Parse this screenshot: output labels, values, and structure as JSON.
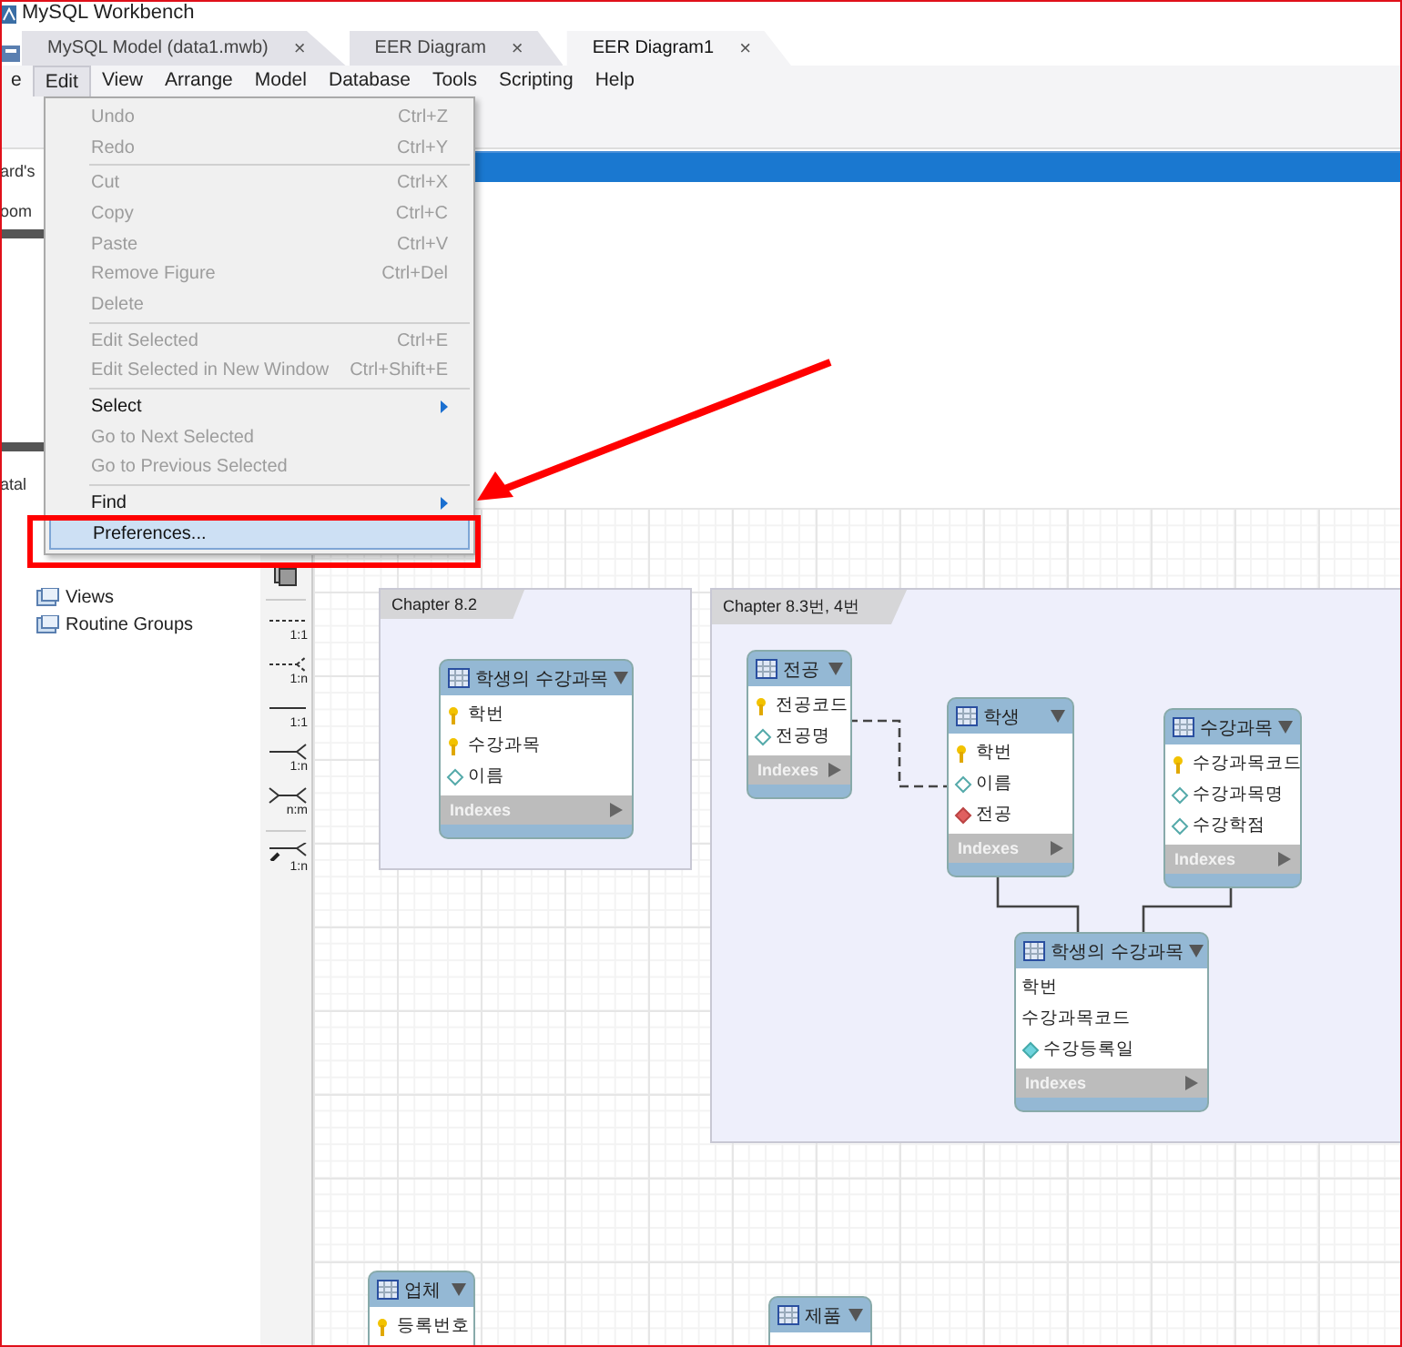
{
  "window": {
    "title": "MySQL Workbench"
  },
  "tabs": [
    {
      "label": "MySQL Model (data1.mwb)",
      "close": "×",
      "selected": false
    },
    {
      "label": "EER Diagram",
      "close": "×",
      "selected": false
    },
    {
      "label": "EER Diagram1",
      "close": "×",
      "selected": true
    }
  ],
  "menu_bar": [
    {
      "label": "e",
      "selected": false
    },
    {
      "label": "Edit",
      "selected": true
    },
    {
      "label": "View",
      "selected": false
    },
    {
      "label": "Arrange",
      "selected": false
    },
    {
      "label": "Model",
      "selected": false
    },
    {
      "label": "Database",
      "selected": false
    },
    {
      "label": "Tools",
      "selected": false
    },
    {
      "label": "Scripting",
      "selected": false
    },
    {
      "label": "Help",
      "selected": false
    }
  ],
  "edit_menu": [
    {
      "kind": "item",
      "label": "Undo",
      "shortcut": "Ctrl+Z",
      "disabled": true,
      "selected": false
    },
    {
      "kind": "item",
      "label": "Redo",
      "shortcut": "Ctrl+Y",
      "disabled": true,
      "selected": false
    },
    {
      "kind": "separator"
    },
    {
      "kind": "item",
      "label": "Cut",
      "shortcut": "Ctrl+X",
      "disabled": true,
      "selected": false
    },
    {
      "kind": "item",
      "label": "Copy",
      "shortcut": "Ctrl+C",
      "disabled": true,
      "selected": false
    },
    {
      "kind": "item",
      "label": "Paste",
      "shortcut": "Ctrl+V",
      "disabled": true,
      "selected": false
    },
    {
      "kind": "item",
      "label": "Remove Figure",
      "shortcut": "Ctrl+Del",
      "disabled": true,
      "selected": false
    },
    {
      "kind": "item",
      "label": "Delete",
      "disabled": true,
      "selected": false
    },
    {
      "kind": "separator"
    },
    {
      "kind": "item",
      "label": "Edit Selected",
      "shortcut": "Ctrl+E",
      "disabled": true,
      "selected": false
    },
    {
      "kind": "item",
      "label": "Edit Selected in New Window",
      "shortcut": "Ctrl+Shift+E",
      "disabled": true,
      "selected": false
    },
    {
      "kind": "separator"
    },
    {
      "kind": "submenu",
      "label": "Select",
      "disabled": false,
      "selected": false
    },
    {
      "kind": "item",
      "label": "Go to Next Selected",
      "disabled": true,
      "selected": false
    },
    {
      "kind": "item",
      "label": "Go to Previous Selected",
      "disabled": true,
      "selected": false
    },
    {
      "kind": "separator"
    },
    {
      "kind": "submenu",
      "label": "Find",
      "disabled": false,
      "selected": false
    },
    {
      "kind": "item",
      "label": "Preferences...",
      "disabled": false,
      "selected": true
    }
  ],
  "sidebar": {
    "fragments": [
      "ard's",
      "oom",
      "atal"
    ],
    "tree": [
      {
        "label": "Views"
      },
      {
        "label": "Routine Groups"
      }
    ]
  },
  "diagram_tools": [
    {
      "kind": "dashed-one",
      "label": "1:1"
    },
    {
      "kind": "dashed-many",
      "label": "1:n"
    },
    {
      "kind": "solid-one",
      "label": "1:1"
    },
    {
      "kind": "solid-many",
      "label": "1:n"
    },
    {
      "kind": "many-many",
      "label": "n:m"
    },
    {
      "kind": "pick",
      "label": "1:n"
    }
  ],
  "canvas": {
    "layers": [
      {
        "title": "Chapter 8.2"
      },
      {
        "title": "Chapter 8.3번, 4번"
      }
    ],
    "tables": [
      {
        "name": "학생의 수강과목",
        "indexes": "Indexes",
        "columns": [
          {
            "name": "학번",
            "kind": "key"
          },
          {
            "name": "수강과목",
            "kind": "key"
          },
          {
            "name": "이름",
            "kind": "attr"
          }
        ]
      },
      {
        "name": "전공",
        "indexes": "Indexes",
        "columns": [
          {
            "name": "전공코드",
            "kind": "key"
          },
          {
            "name": "전공명",
            "kind": "attr"
          }
        ]
      },
      {
        "name": "학생",
        "indexes": "Indexes",
        "columns": [
          {
            "name": "학번",
            "kind": "key"
          },
          {
            "name": "이름",
            "kind": "attr"
          },
          {
            "name": "전공",
            "kind": "fk"
          }
        ]
      },
      {
        "name": "수강과목",
        "indexes": "Indexes",
        "columns": [
          {
            "name": "수강과목코드",
            "kind": "key"
          },
          {
            "name": "수강과목명",
            "kind": "attr"
          },
          {
            "name": "수강학점",
            "kind": "attr"
          }
        ]
      },
      {
        "name": "학생의 수강과목",
        "indexes": "Indexes",
        "columns": [
          {
            "name": "학번",
            "kind": "plain"
          },
          {
            "name": "수강과목코드",
            "kind": "plain"
          },
          {
            "name": "수강등록일",
            "kind": "nn"
          }
        ]
      },
      {
        "name": "업체",
        "columns": [
          {
            "name": "등록번호",
            "kind": "key"
          }
        ]
      },
      {
        "name": "제품"
      }
    ],
    "relationships": [
      {
        "kind": "dashed"
      },
      {
        "kind": "solid"
      },
      {
        "kind": "solid"
      }
    ]
  },
  "annotations": [
    {
      "kind": "frame"
    },
    {
      "kind": "box"
    },
    {
      "kind": "arrow"
    }
  ]
}
